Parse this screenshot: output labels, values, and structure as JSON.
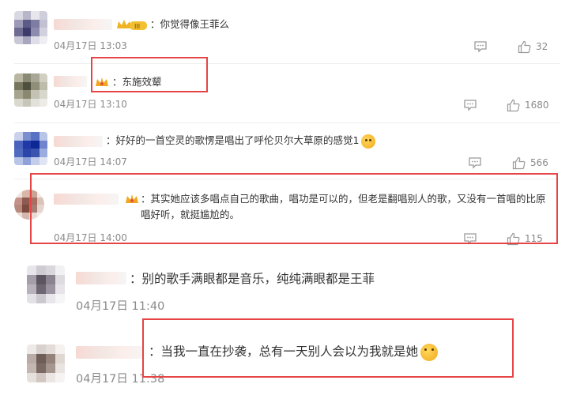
{
  "comments": [
    {
      "text": "：你觉得像王菲么",
      "time": "04月17日 13:03",
      "likes": "32"
    },
    {
      "text": "：东施效颦",
      "time": "04月17日 13:10",
      "likes": "1680"
    },
    {
      "text": "：好好的一首空灵的歌愣是唱出了呼伦贝尔大草原的感觉1",
      "time": "04月17日 14:07",
      "likes": "566"
    },
    {
      "text": "：其实她应该多唱点自己的歌曲，唱功是可以的，但老是翻唱别人的歌，又没有一首唱的比原唱好听，就挺尴尬的。",
      "time": "04月17日 14:00",
      "likes": "115"
    }
  ],
  "replies": [
    {
      "text": "：别的歌手满眼都是音乐，纯纯满眼都是王菲",
      "time": "04月17日 11:40"
    },
    {
      "text": "：当我一直在抄袭，总有一天别人会以为我就是她",
      "time": "04月17日 11:38"
    }
  ],
  "colors": {
    "highlight": "#e64545",
    "muted": "#8a8a8a"
  }
}
